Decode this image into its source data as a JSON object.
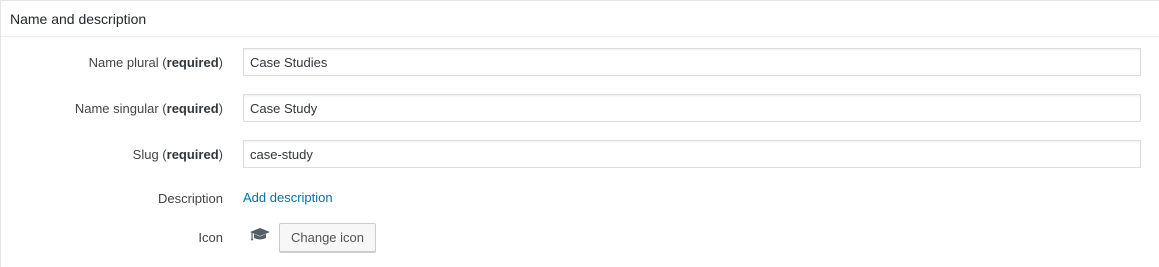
{
  "section": {
    "title": "Name and description"
  },
  "fields": {
    "name_plural": {
      "label": "Name plural",
      "required": "required",
      "value": "Case Studies"
    },
    "name_singular": {
      "label": "Name singular",
      "required": "required",
      "value": "Case Study"
    },
    "slug": {
      "label": "Slug",
      "required": "required",
      "value": "case-study"
    },
    "description": {
      "label": "Description",
      "link": "Add description"
    },
    "icon": {
      "label": "Icon",
      "icon_name": "graduation-cap-icon",
      "button": "Change icon"
    }
  },
  "colors": {
    "link": "#0073aa",
    "border": "#dcdcdc"
  }
}
